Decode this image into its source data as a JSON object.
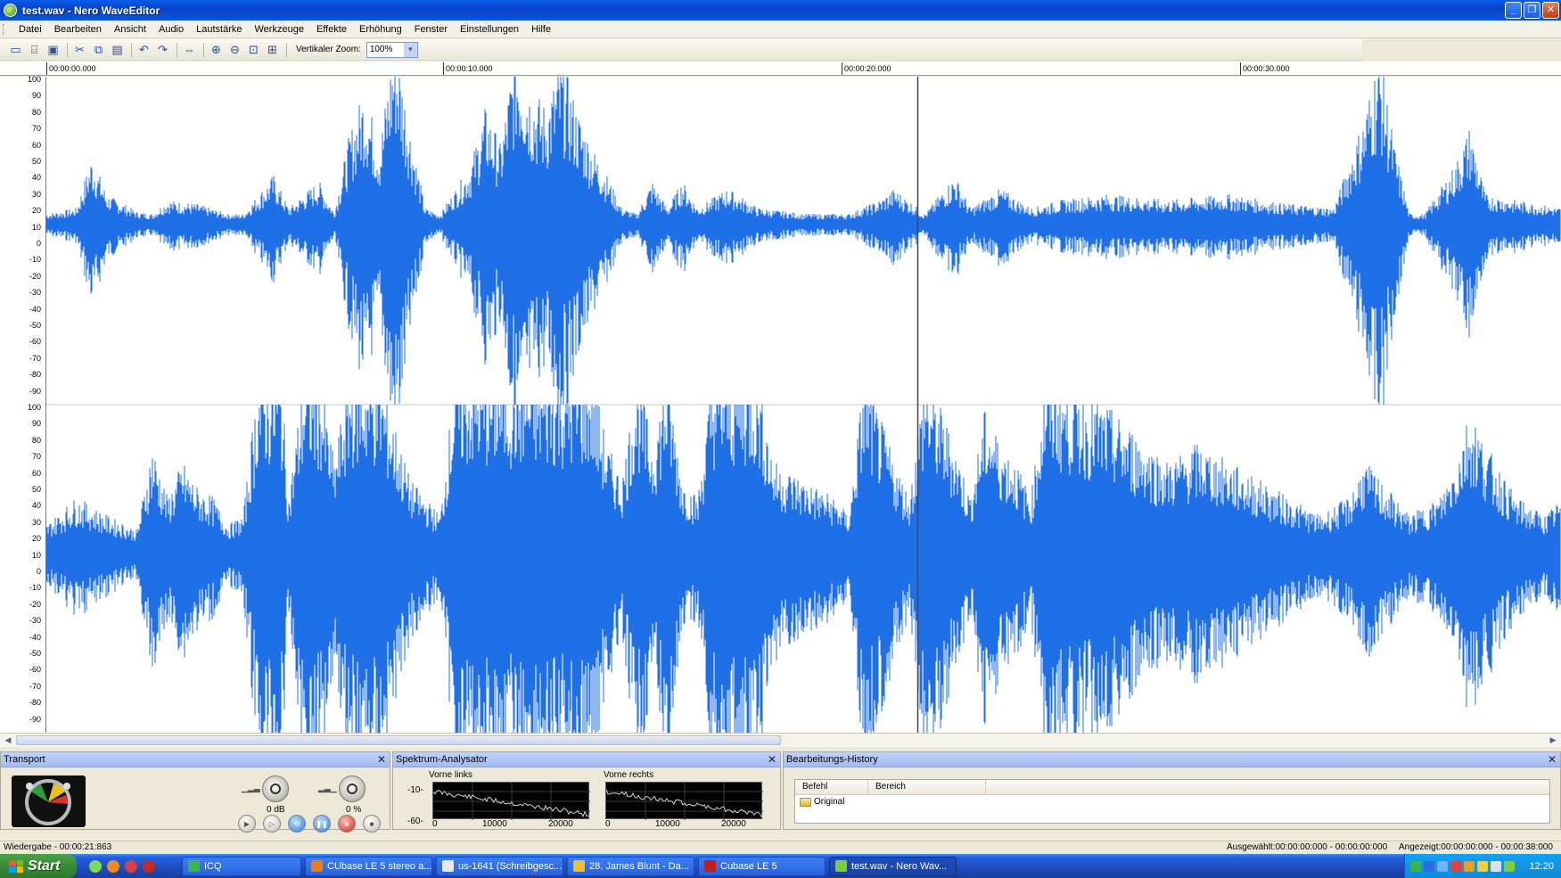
{
  "window": {
    "title": "test.wav - Nero WaveEditor",
    "minimize_glyph": "_",
    "maximize_glyph": "❐",
    "close_glyph": "✕"
  },
  "menu": [
    "Datei",
    "Bearbeiten",
    "Ansicht",
    "Audio",
    "Lautstärke",
    "Werkzeuge",
    "Effekte",
    "Erhöhung",
    "Fenster",
    "Einstellungen",
    "Hilfe"
  ],
  "toolbar": {
    "buttons": [
      {
        "name": "new-file-icon",
        "glyph": "▭"
      },
      {
        "name": "open-folder-icon",
        "glyph": "⌸"
      },
      {
        "name": "save-icon",
        "glyph": "▣"
      },
      {
        "name": "cut-icon",
        "glyph": "✂"
      },
      {
        "name": "copy-icon",
        "glyph": "⧉"
      },
      {
        "name": "paste-icon",
        "glyph": "▤"
      },
      {
        "name": "undo-icon",
        "glyph": "↶"
      },
      {
        "name": "redo-icon",
        "glyph": "↷"
      },
      {
        "name": "select-all-icon",
        "glyph": "⇔"
      },
      {
        "name": "zoom-in-icon",
        "glyph": "⊕"
      },
      {
        "name": "zoom-out-icon",
        "glyph": "⊖"
      },
      {
        "name": "zoom-selection-icon",
        "glyph": "⊡"
      },
      {
        "name": "zoom-full-icon",
        "glyph": "⊞"
      }
    ],
    "vertical_zoom_label": "Vertikaler Zoom:",
    "vertical_zoom_value": "100%",
    "dropdown_arrow": "▼"
  },
  "ruler": {
    "labels": [
      "00:00:00.000",
      "00:00:10.000",
      "00:00:20.000",
      "00:00:30.000"
    ]
  },
  "y_axis": {
    "channel_top": [
      "100",
      "90",
      "80",
      "70",
      "60",
      "50",
      "40",
      "30",
      "20",
      "10",
      "0",
      "-10",
      "-20",
      "-30",
      "-40",
      "-50",
      "-60",
      "-70",
      "-80",
      "-90"
    ],
    "channel_bottom": [
      "100",
      "90",
      "80",
      "70",
      "60",
      "50",
      "40",
      "30",
      "20",
      "10",
      "0",
      "-10",
      "-20",
      "-30",
      "-40",
      "-50",
      "-60",
      "-70",
      "-80",
      "-90"
    ]
  },
  "scrollbar": {
    "left_arrow": "◀",
    "right_arrow": "▶"
  },
  "colors": {
    "waveform": "#1f6fe6",
    "waveform_light": "#5f9cf5",
    "cursor": "#444444",
    "panel_header": "#a8bef0"
  },
  "playback_cursor_seconds": 21.863,
  "view_seconds": 38.0,
  "transport": {
    "title": "Transport",
    "close": "✕",
    "gain_label": "0 dB",
    "pan_label": "0 %",
    "buttons": [
      {
        "name": "play-button",
        "glyph": "▶"
      },
      {
        "name": "play-selection-button",
        "glyph": "▷"
      },
      {
        "name": "loop-button",
        "glyph": "⟲"
      },
      {
        "name": "pause-button",
        "glyph": "❚❚"
      },
      {
        "name": "record-button",
        "glyph": "●"
      },
      {
        "name": "stop-button",
        "glyph": "■"
      }
    ]
  },
  "spectrum": {
    "title": "Spektrum-Analysator",
    "close": "✕",
    "left_label": "Vorne links",
    "right_label": "Vorne rechts",
    "y_top": "-10-",
    "y_bottom": "-60-",
    "x_ticks": [
      "0",
      "10000",
      "20000"
    ]
  },
  "history": {
    "title": "Bearbeitungs-History",
    "close": "✕",
    "columns": [
      "Befehl",
      "Bereich"
    ],
    "rows": [
      {
        "command": "Original"
      }
    ]
  },
  "status": {
    "playback": "Wiedergabe - 00:00:21:863",
    "selected": "Ausgewählt:00:00:00:000 - 00:00:00:000",
    "shown": "Angezeigt:00:00:00:000 - 00:00:38:000"
  },
  "taskbar": {
    "start_label": "Start",
    "items": [
      {
        "label": "ICQ",
        "color": "#3bb54a"
      },
      {
        "label": "CUbase LE 5 stereo a...",
        "color": "#f07a1a"
      },
      {
        "label": "us-1641 (Schreibgesc...",
        "color": "#e8e8e8"
      },
      {
        "label": "28. James Blunt - Da...",
        "color": "#f0c030"
      },
      {
        "label": "Cubase LE 5",
        "color": "#c02020"
      },
      {
        "label": "test.wav - Nero Wav...",
        "color": "#7ccf3a"
      }
    ],
    "clock": "12:20"
  }
}
